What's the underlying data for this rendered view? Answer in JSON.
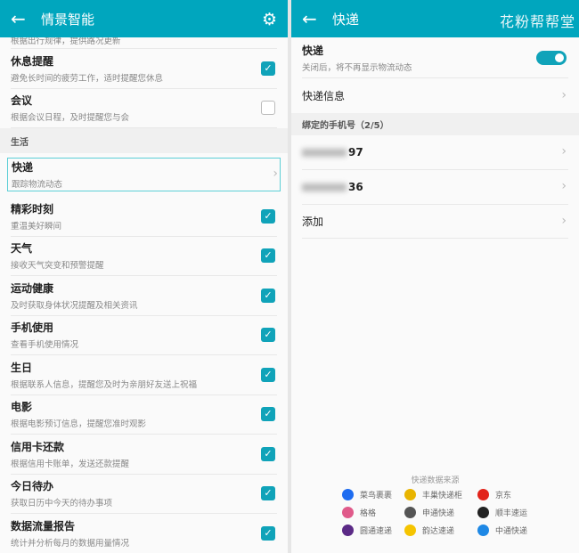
{
  "left": {
    "title": "情景智能",
    "back_icon": "arrow-left",
    "settings_icon": "gear",
    "partial_subtitle": "根据出行规律，提供路况更新",
    "items_top": [
      {
        "title": "休息提醒",
        "subtitle": "避免长时间的疲劳工作，适时提醒您休息",
        "checked": true
      },
      {
        "title": "会议",
        "subtitle": "根据会议日程，及时提醒您与会",
        "checked": false
      }
    ],
    "section": "生活",
    "selected": {
      "title": "快递",
      "subtitle": "跟踪物流动态"
    },
    "items": [
      {
        "title": "精彩时刻",
        "subtitle": "重温美好瞬间",
        "checked": true
      },
      {
        "title": "天气",
        "subtitle": "接收天气突变和预警提醒",
        "checked": true
      },
      {
        "title": "运动健康",
        "subtitle": "及时获取身体状况提醒及相关资讯",
        "checked": true
      },
      {
        "title": "手机使用",
        "subtitle": "查看手机使用情况",
        "checked": true
      },
      {
        "title": "生日",
        "subtitle": "根据联系人信息，提醒您及时为亲朋好友送上祝福",
        "checked": true
      },
      {
        "title": "电影",
        "subtitle": "根据电影预订信息，提醒您准时观影",
        "checked": true
      },
      {
        "title": "信用卡还款",
        "subtitle": "根据信用卡账单，发送还款提醒",
        "checked": true
      },
      {
        "title": "今日待办",
        "subtitle": "获取日历中今天的待办事项",
        "checked": true
      },
      {
        "title": "数据流量报告",
        "subtitle": "统计并分析每月的数据用量情况",
        "checked": true
      }
    ]
  },
  "right": {
    "title": "快递",
    "watermark": "花粉帮帮堂",
    "toggle": {
      "title": "快递",
      "subtitle": "关闭后，将不再显示物流动态",
      "on": true
    },
    "info": "快递信息",
    "section": "绑定的手机号（2/5）",
    "phones": [
      "97",
      "36"
    ],
    "add": "添加",
    "source_title": "快递数据来源",
    "sources": [
      {
        "name": "菜鸟裹裹",
        "color": "#1e6cf0"
      },
      {
        "name": "丰巢快递柜",
        "color": "#e8b400"
      },
      {
        "name": "京东",
        "color": "#e2231a"
      },
      {
        "name": "格格",
        "color": "#e05a8a"
      },
      {
        "name": "申通快递",
        "color": "#555555"
      },
      {
        "name": "顺丰速运",
        "color": "#222222"
      },
      {
        "name": "圆通速递",
        "color": "#5b2a86"
      },
      {
        "name": "韵达速递",
        "color": "#f5c400"
      },
      {
        "name": "中通快递",
        "color": "#1e88e5"
      }
    ]
  }
}
